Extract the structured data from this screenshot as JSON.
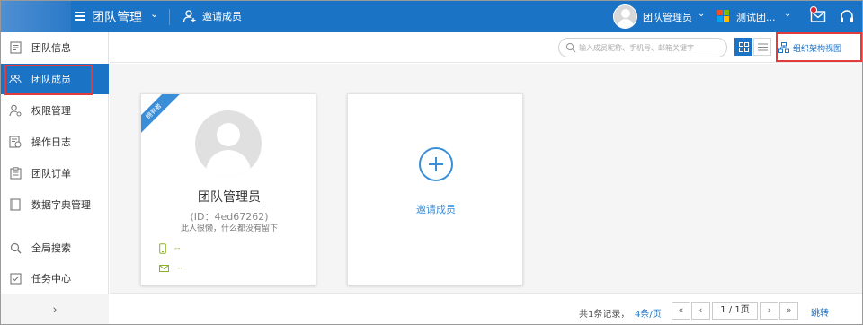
{
  "topbar": {
    "title": "团队管理",
    "invite_label": "邀请成员",
    "user_name": "团队管理员",
    "team_name": "测试团...",
    "brand_color": "#1b73c6"
  },
  "sidebar": {
    "items": [
      {
        "label": "团队信息",
        "icon": "team-info-icon"
      },
      {
        "label": "团队成员",
        "icon": "team-members-icon",
        "active": true
      },
      {
        "label": "权限管理",
        "icon": "permission-icon"
      },
      {
        "label": "操作日志",
        "icon": "log-icon"
      },
      {
        "label": "团队订单",
        "icon": "order-icon"
      },
      {
        "label": "数据字典管理",
        "icon": "dictionary-icon"
      },
      {
        "label": "全局搜索",
        "icon": "search-icon"
      },
      {
        "label": "任务中心",
        "icon": "task-icon"
      }
    ],
    "collapse": "›"
  },
  "toolbar": {
    "search_placeholder": "输入成员昵称、手机号、邮箱关键字",
    "org_view_label": "组织架构视图"
  },
  "member_card": {
    "ribbon": "拥有者",
    "name": "团队管理员",
    "id_text": "(ID：4ed67262)",
    "bio": "此人很懒，什么都没有留下",
    "phone": "--",
    "email": "--"
  },
  "invite_card": {
    "label": "邀请成员"
  },
  "pagination": {
    "total": "共1条记录，",
    "per_page": "4条/页",
    "first": "«",
    "prev": "‹",
    "page": "1 / 1页",
    "next": "›",
    "last": "»",
    "jump": "跳转"
  }
}
